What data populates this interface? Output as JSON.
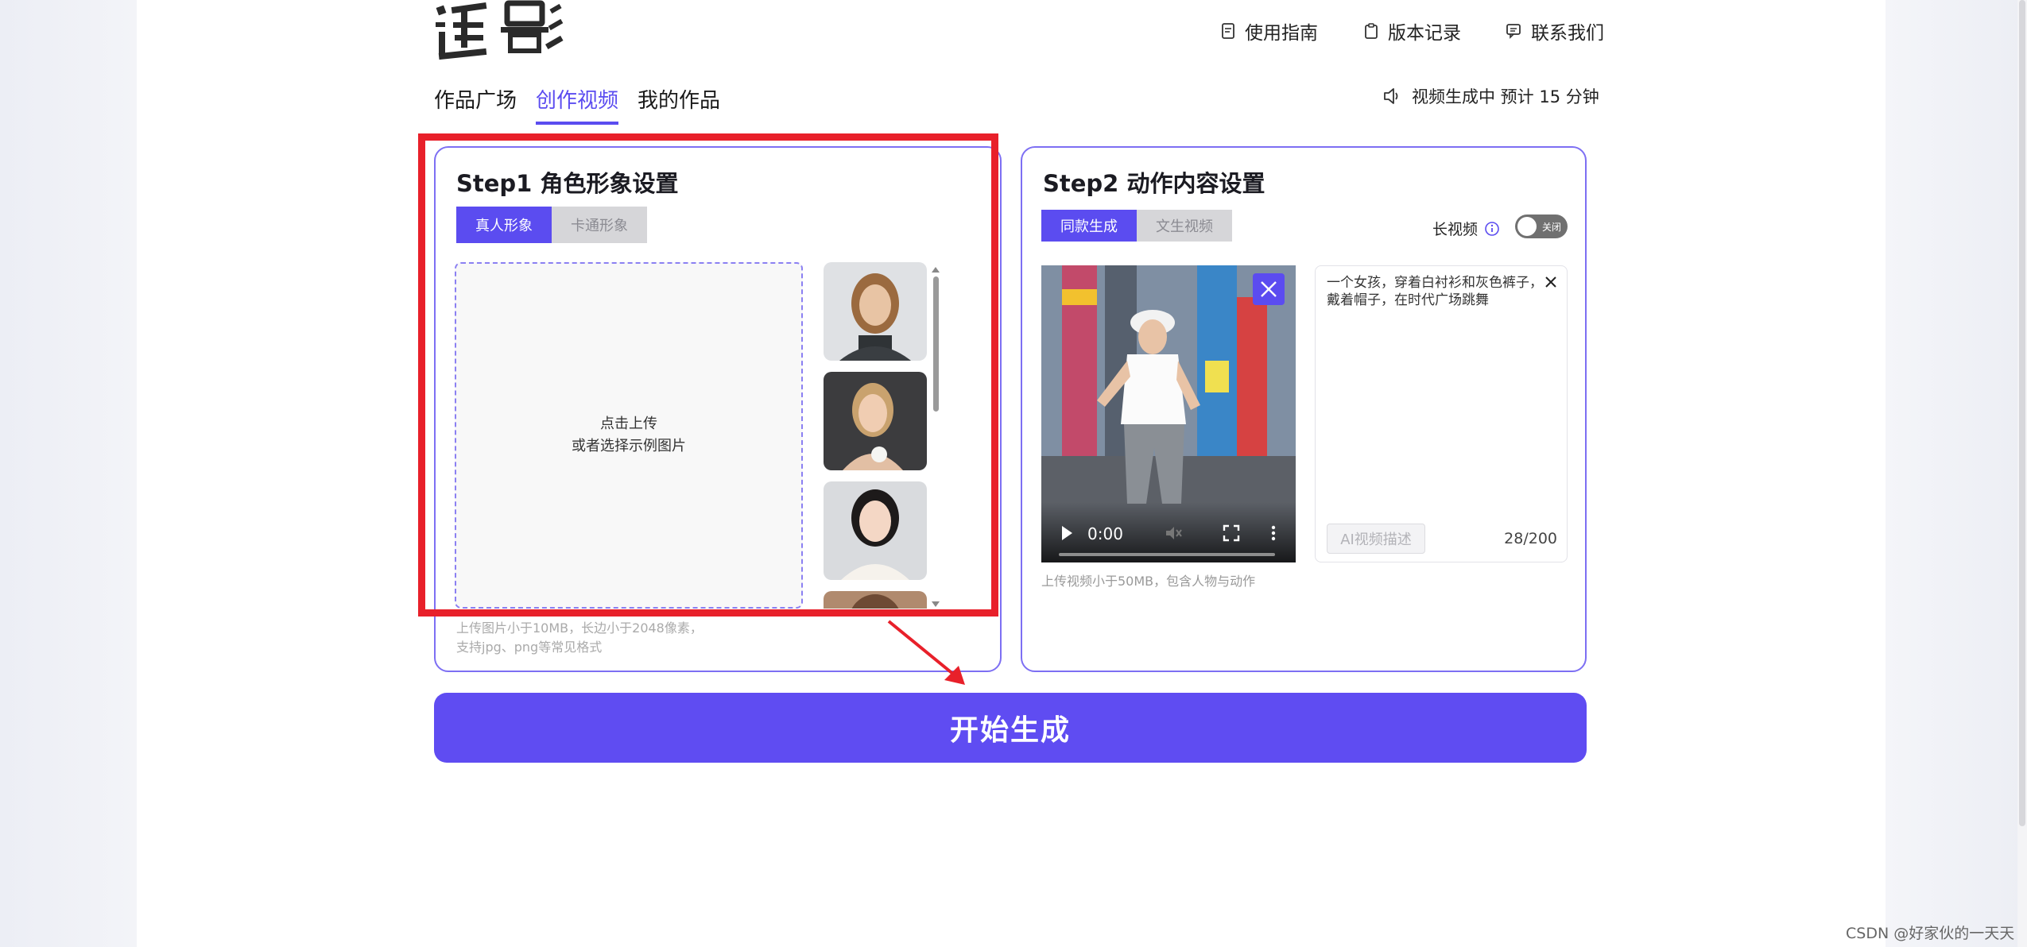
{
  "header": {
    "logo_text": "追影",
    "nav": [
      {
        "label": "使用指南",
        "icon": "guide-icon"
      },
      {
        "label": "版本记录",
        "icon": "clipboard-icon"
      },
      {
        "label": "联系我们",
        "icon": "chat-icon"
      }
    ]
  },
  "tabs": [
    {
      "label": "作品广场",
      "active": false
    },
    {
      "label": "创作视频",
      "active": true
    },
    {
      "label": "我的作品",
      "active": false
    }
  ],
  "notice": {
    "text": "视频生成中 预计 15 分钟",
    "icon": "speaker-icon"
  },
  "step1": {
    "title": "Step1 角色形象设置",
    "segments": [
      {
        "label": "真人形象",
        "active": true
      },
      {
        "label": "卡通形象",
        "active": false
      }
    ],
    "upload": {
      "line1": "点击上传",
      "line2": "或者选择示例图片"
    },
    "hint_line1": "上传图片小于10MB，长边小于2048像素，",
    "hint_line2": "支持jpg、png等常见格式",
    "thumbnails": [
      "portrait-woman-1",
      "portrait-woman-2",
      "portrait-woman-3",
      "portrait-woman-4"
    ]
  },
  "step2": {
    "title": "Step2 动作内容设置",
    "segments": [
      {
        "label": "同款生成",
        "active": true
      },
      {
        "label": "文生视频",
        "active": false
      }
    ],
    "long_video_label": "长视频",
    "toggle_label": "关闭",
    "toggle_on": false,
    "video": {
      "time": "0:00",
      "hint": "上传视频小于50MB，包含人物与动作"
    },
    "description": "一个女孩，穿着白衬衫和灰色裤子，戴着帽子，在时代广场跳舞",
    "ai_button": "AI视频描述",
    "char_count": "28/200"
  },
  "start_button": "开始生成",
  "watermark": "CSDN @好家伙的一天天",
  "colors": {
    "accent": "#5b4cf0",
    "annotation": "#e8202a"
  }
}
